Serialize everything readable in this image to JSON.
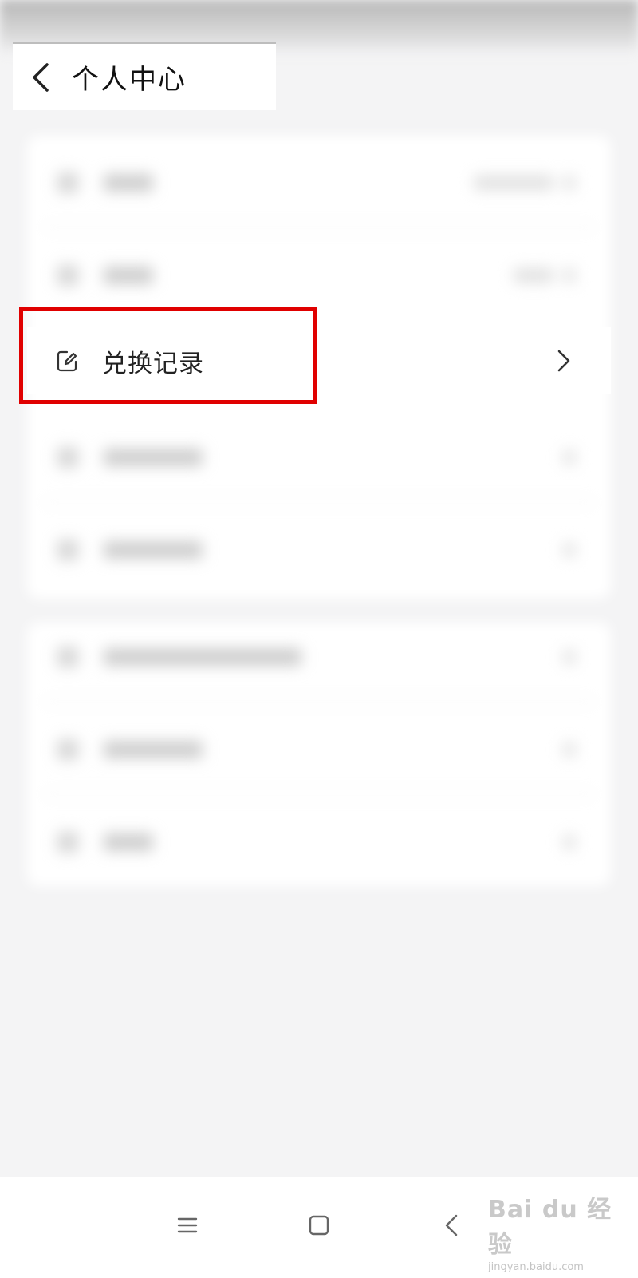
{
  "header": {
    "title": "个人中心"
  },
  "list": {
    "highlighted_item": {
      "label": "兑换记录",
      "icon": "edit-icon"
    }
  },
  "navigation": {
    "buttons": [
      "menu-icon",
      "home-icon",
      "back-icon"
    ]
  },
  "watermark": {
    "logo": "Bai du 经验",
    "url": "jingyan.baidu.com"
  },
  "colors": {
    "highlight": "#e00000",
    "background": "#f4f4f5",
    "card": "#ffffff"
  }
}
